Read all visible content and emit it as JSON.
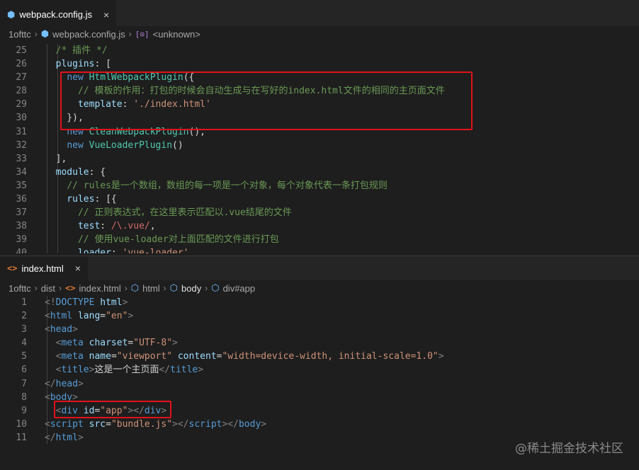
{
  "pane1": {
    "tab": {
      "label": "webpack.config.js",
      "close": "×",
      "icon": "js-file-icon"
    },
    "breadcrumb": {
      "folder": "1ofttc",
      "file": "webpack.config.js",
      "symbol": "<unknown>"
    },
    "lines": [
      {
        "num": "25",
        "tokens": [
          [
            "punc",
            "  "
          ],
          [
            "cmt",
            "/* 插件 */"
          ]
        ]
      },
      {
        "num": "26",
        "tokens": [
          [
            "prop",
            "  plugins"
          ],
          [
            "txt",
            ": ["
          ]
        ]
      },
      {
        "num": "27",
        "tokens": [
          [
            "txt",
            "    "
          ],
          [
            "kw",
            "new "
          ],
          [
            "cls",
            "HtmlWebpackPlugin"
          ],
          [
            "txt",
            "({"
          ]
        ]
      },
      {
        "num": "28",
        "tokens": [
          [
            "txt",
            "      "
          ],
          [
            "cmt",
            "// 模板的作用：打包的时候会自动生成与在写好的index.html文件的相同的主页面文件"
          ]
        ]
      },
      {
        "num": "29",
        "tokens": [
          [
            "txt",
            "      "
          ],
          [
            "prop",
            "template"
          ],
          [
            "txt",
            ": "
          ],
          [
            "str",
            "'./index.html'"
          ]
        ]
      },
      {
        "num": "30",
        "tokens": [
          [
            "txt",
            "    }),"
          ]
        ]
      },
      {
        "num": "31",
        "tokens": [
          [
            "txt",
            "    "
          ],
          [
            "kw",
            "new "
          ],
          [
            "cls",
            "CleanWebpackPlugin"
          ],
          [
            "txt",
            "(),"
          ]
        ]
      },
      {
        "num": "32",
        "tokens": [
          [
            "txt",
            "    "
          ],
          [
            "kw",
            "new "
          ],
          [
            "cls",
            "VueLoaderPlugin"
          ],
          [
            "txt",
            "()"
          ]
        ]
      },
      {
        "num": "33",
        "tokens": [
          [
            "txt",
            "  ],"
          ]
        ]
      },
      {
        "num": "34",
        "tokens": [
          [
            "prop",
            "  module"
          ],
          [
            "txt",
            ": {"
          ]
        ]
      },
      {
        "num": "35",
        "tokens": [
          [
            "txt",
            "    "
          ],
          [
            "cmt",
            "// rules是一个数组，数组的每一项是一个对象，每个对象代表一条打包规则"
          ]
        ]
      },
      {
        "num": "36",
        "tokens": [
          [
            "prop",
            "    rules"
          ],
          [
            "txt",
            ": [{"
          ]
        ]
      },
      {
        "num": "37",
        "tokens": [
          [
            "txt",
            "      "
          ],
          [
            "cmt",
            "// 正则表达式，在这里表示匹配以.vue结尾的文件"
          ]
        ]
      },
      {
        "num": "38",
        "tokens": [
          [
            "prop",
            "      test"
          ],
          [
            "txt",
            ": "
          ],
          [
            "rgx",
            "/\\.vue/"
          ],
          [
            "txt",
            ","
          ]
        ]
      },
      {
        "num": "39",
        "tokens": [
          [
            "txt",
            "      "
          ],
          [
            "cmt",
            "// 使用vue-loader对上面匹配的文件进行打包"
          ]
        ]
      },
      {
        "num": "40",
        "tokens": [
          [
            "prop",
            "      loader"
          ],
          [
            "txt",
            ": "
          ],
          [
            "str",
            "'vue-loader'"
          ]
        ]
      }
    ]
  },
  "pane2": {
    "tab": {
      "label": "index.html",
      "close": "×",
      "icon": "html-file-icon"
    },
    "breadcrumb": {
      "folder": "1ofttc",
      "subfolder": "dist",
      "file": "index.html",
      "path": [
        "html",
        "body",
        "div#app"
      ]
    },
    "lines": [
      {
        "num": "1",
        "tokens": [
          [
            "punc",
            "<!"
          ],
          [
            "tag",
            "DOCTYPE "
          ],
          [
            "attr",
            "html"
          ],
          [
            "punc",
            ">"
          ]
        ]
      },
      {
        "num": "2",
        "tokens": [
          [
            "punc",
            "<"
          ],
          [
            "tag",
            "html "
          ],
          [
            "attr",
            "lang"
          ],
          [
            "txt",
            "="
          ],
          [
            "str",
            "\"en\""
          ],
          [
            "punc",
            ">"
          ]
        ]
      },
      {
        "num": "3",
        "tokens": [
          [
            "punc",
            "<"
          ],
          [
            "tag",
            "head"
          ],
          [
            "punc",
            ">"
          ]
        ]
      },
      {
        "num": "4",
        "tokens": [
          [
            "txt",
            "  "
          ],
          [
            "punc",
            "<"
          ],
          [
            "tag",
            "meta "
          ],
          [
            "attr",
            "charset"
          ],
          [
            "txt",
            "="
          ],
          [
            "str",
            "\"UTF-8\""
          ],
          [
            "punc",
            ">"
          ]
        ]
      },
      {
        "num": "5",
        "tokens": [
          [
            "txt",
            "  "
          ],
          [
            "punc",
            "<"
          ],
          [
            "tag",
            "meta "
          ],
          [
            "attr",
            "name"
          ],
          [
            "txt",
            "="
          ],
          [
            "str",
            "\"viewport\" "
          ],
          [
            "attr",
            "content"
          ],
          [
            "txt",
            "="
          ],
          [
            "str",
            "\"width=device-width, initial-scale=1.0\""
          ],
          [
            "punc",
            ">"
          ]
        ]
      },
      {
        "num": "6",
        "tokens": [
          [
            "txt",
            "  "
          ],
          [
            "punc",
            "<"
          ],
          [
            "tag",
            "title"
          ],
          [
            "punc",
            ">"
          ],
          [
            "txt",
            "这是一个主页面"
          ],
          [
            "punc",
            "</"
          ],
          [
            "tag",
            "title"
          ],
          [
            "punc",
            ">"
          ]
        ]
      },
      {
        "num": "7",
        "tokens": [
          [
            "punc",
            "</"
          ],
          [
            "tag",
            "head"
          ],
          [
            "punc",
            ">"
          ]
        ]
      },
      {
        "num": "8",
        "tokens": [
          [
            "punc",
            "<"
          ],
          [
            "tag",
            "body"
          ],
          [
            "punc",
            ">"
          ]
        ]
      },
      {
        "num": "9",
        "tokens": [
          [
            "txt",
            "  "
          ],
          [
            "punc",
            "<"
          ],
          [
            "tag",
            "div "
          ],
          [
            "attr",
            "id"
          ],
          [
            "txt",
            "="
          ],
          [
            "str",
            "\"app\""
          ],
          [
            "punc",
            "></"
          ],
          [
            "tag",
            "div"
          ],
          [
            "punc",
            ">"
          ]
        ]
      },
      {
        "num": "10",
        "tokens": [
          [
            "punc",
            "<"
          ],
          [
            "tag",
            "script "
          ],
          [
            "attr",
            "src"
          ],
          [
            "txt",
            "="
          ],
          [
            "str",
            "\"bundle.js\""
          ],
          [
            "punc",
            "></"
          ],
          [
            "tag",
            "script"
          ],
          [
            "punc",
            "></"
          ],
          [
            "tag",
            "body"
          ],
          [
            "punc",
            ">"
          ]
        ]
      },
      {
        "num": "11",
        "tokens": [
          [
            "punc",
            "</"
          ],
          [
            "tag",
            "html"
          ],
          [
            "punc",
            ">"
          ]
        ]
      }
    ]
  },
  "watermark": "@稀土掘金技术社区",
  "colors": {
    "highlight_box": "#e0121b",
    "background": "#1e1e1e",
    "tabbar": "#252526"
  }
}
